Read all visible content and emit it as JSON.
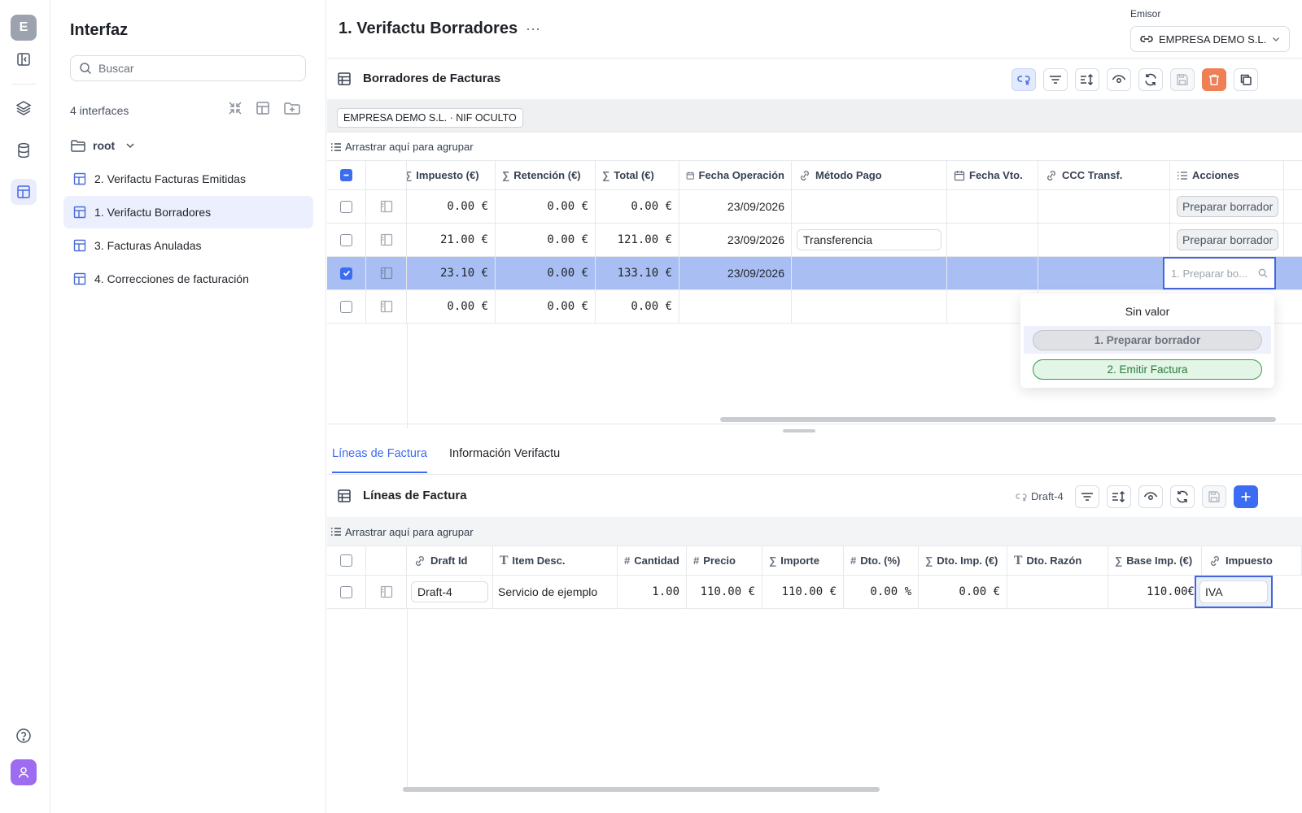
{
  "rail": {
    "workspace_initial": "E"
  },
  "sidebar": {
    "title": "Interfaz",
    "search_placeholder": "Buscar",
    "count_label": "4 interfaces",
    "root_label": "root",
    "items": [
      {
        "label": "2. Verifactu Facturas Emitidas"
      },
      {
        "label": "1. Verifactu Borradores"
      },
      {
        "label": "3. Facturas Anuladas"
      },
      {
        "label": "4. Correcciones de facturación"
      }
    ]
  },
  "header": {
    "title": "1. Verifactu Borradores",
    "emisor_label": "Emisor",
    "emisor_value": "EMPRESA DEMO S.L."
  },
  "drafts": {
    "title": "Borradores de Facturas",
    "filter_chip": "EMPRESA DEMO S.L. · NIF OCULTO",
    "group_hint": "Arrastrar aquí para agrupar",
    "columns": [
      "Impuesto (€)",
      "Retención (€)",
      "Total (€)",
      "Fecha Operación",
      "Método Pago",
      "Fecha Vto.",
      "CCC Transf.",
      "Acciones"
    ],
    "rows": [
      {
        "impuesto": "0.00 €",
        "retencion": "0.00 €",
        "total": "0.00 €",
        "fecha": "23/09/2026",
        "metodo": "",
        "accion": "Preparar borrador"
      },
      {
        "impuesto": "21.00 €",
        "retencion": "0.00 €",
        "total": "121.00 €",
        "fecha": "23/09/2026",
        "metodo": "Transferencia",
        "accion": "Preparar borrador"
      },
      {
        "impuesto": "23.10 €",
        "retencion": "0.00 €",
        "total": "133.10 €",
        "fecha": "23/09/2026",
        "metodo": "",
        "accion": ""
      },
      {
        "impuesto": "0.00 €",
        "retencion": "0.00 €",
        "total": "0.00 €",
        "fecha": "",
        "metodo": "",
        "accion": ""
      }
    ],
    "action_input_placeholder": "1. Preparar bo...",
    "dropdown": {
      "empty_option": "Sin valor",
      "options": [
        "1. Preparar borrador",
        "2. Emitir Factura"
      ]
    }
  },
  "tabs": [
    "Líneas de Factura",
    "Información Verifactu"
  ],
  "lines": {
    "title": "Líneas de Factura",
    "linked_record": "Draft-4",
    "group_hint": "Arrastrar aquí para agrupar",
    "columns": [
      "Draft Id",
      "Item Desc.",
      "Cantidad",
      "Precio",
      "Importe",
      "Dto. (%)",
      "Dto. Imp. (€)",
      "Dto. Razón",
      "Base Imp. (€)",
      "Impuesto"
    ],
    "rows": [
      {
        "draft_id": "Draft-4",
        "desc": "Servicio de ejemplo",
        "cantidad": "1.00",
        "precio": "110.00 €",
        "importe": "110.00 €",
        "dto_pct": "0.00 %",
        "dto_imp": "0.00 €",
        "dto_razon": "",
        "base": "110.00€",
        "impuesto": "IVA"
      }
    ]
  }
}
